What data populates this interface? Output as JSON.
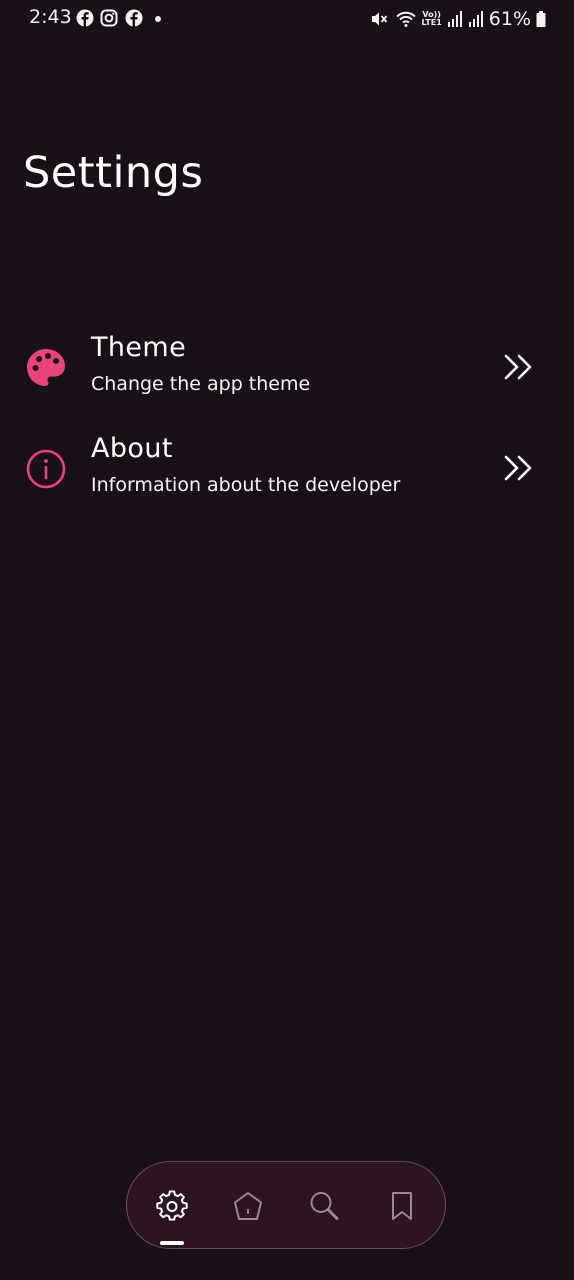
{
  "status_bar": {
    "time": "2:43",
    "battery": "61%",
    "notification_icons": [
      "facebook-icon",
      "instagram-icon",
      "facebook-icon"
    ],
    "volte_label": "Vo)) LTE1"
  },
  "page": {
    "title": "Settings"
  },
  "settings_items": [
    {
      "title": "Theme",
      "subtitle": "Change the app theme",
      "icon": "palette-icon"
    },
    {
      "title": "About",
      "subtitle": "Information about the developer",
      "icon": "info-icon"
    }
  ],
  "bottom_nav": {
    "items": [
      "settings-icon",
      "home-icon",
      "search-icon",
      "bookmark-icon"
    ],
    "active": "settings-icon"
  },
  "colors": {
    "background": "#1a1118",
    "accent": "#e8437a",
    "nav_background": "#2c1521",
    "text": "#ffffff"
  }
}
